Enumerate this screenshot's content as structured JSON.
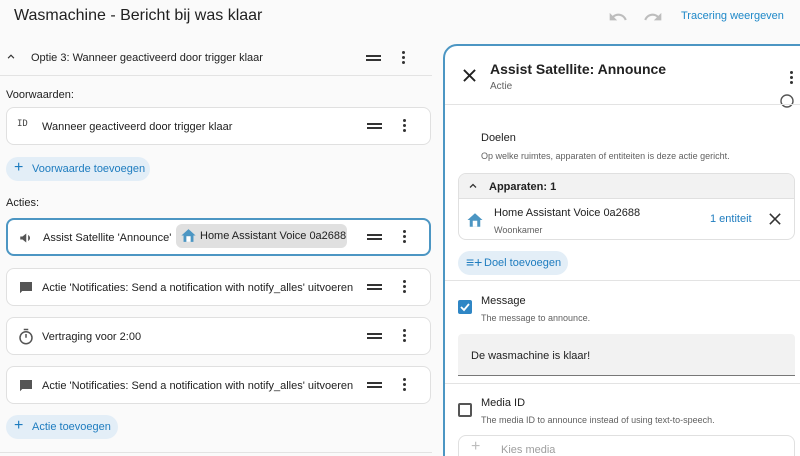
{
  "header": {
    "title": "Wasmachine - Bericht bij was klaar",
    "trace_label": "Tracering weergeven"
  },
  "option": {
    "label": "Optie 3: Wanneer geactiveerd door trigger klaar"
  },
  "conditions": {
    "section_label": "Voorwaarden:",
    "items": [
      {
        "icon_text": "ID",
        "label": "Wanneer geactiveerd door trigger klaar"
      }
    ],
    "add_label": "Voorwaarde toevoegen"
  },
  "actions": {
    "section_label": "Acties:",
    "items": [
      {
        "label": "Assist Satellite 'Announce'",
        "chip": "Home Assistant Voice 0a2688"
      },
      {
        "label": "Actie 'Notificaties: Send a notification with notify_alles' uitvoeren"
      },
      {
        "label": "Vertraging voor 2:00"
      },
      {
        "label": "Actie 'Notificaties: Send a notification with notify_alles' uitvoeren"
      }
    ],
    "add_label": "Actie toevoegen"
  },
  "panel": {
    "title": "Assist Satellite: Announce",
    "subtitle": "Actie",
    "targets": {
      "label": "Doelen",
      "description": "Op welke ruimtes, apparaten of entiteiten is deze actie gericht.",
      "devices_header": "Apparaten: 1",
      "device_name": "Home Assistant Voice 0a2688",
      "device_area": "Woonkamer",
      "entity_count": "1 entiteit",
      "add_target_label": "Doel toevoegen"
    },
    "message": {
      "label": "Message",
      "description": "The message to announce.",
      "value": "De wasmachine is klaar!",
      "checked": true
    },
    "media": {
      "label": "Media ID",
      "description": "The media ID to announce instead of using text-to-speech.",
      "placeholder": "Kies media",
      "checked": false
    }
  },
  "colors": {
    "accent": "#1e7cbf",
    "selected_border": "#4c96c3",
    "checkbox_on": "#2f86c5"
  }
}
